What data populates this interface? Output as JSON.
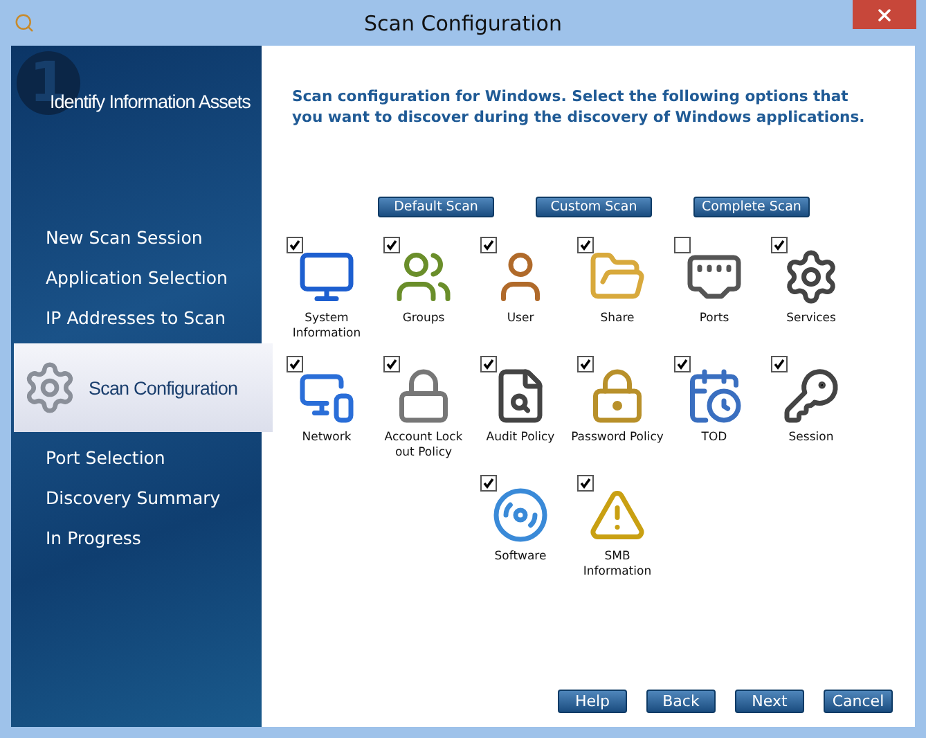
{
  "window": {
    "title": "Scan Configuration"
  },
  "sidebar": {
    "step_number": "1",
    "heading": "Identify Information Assets",
    "items": [
      {
        "label": "New Scan Session",
        "selected": false
      },
      {
        "label": "Application Selection",
        "selected": false
      },
      {
        "label": "IP Addresses to Scan",
        "selected": false
      },
      {
        "label": "Scan Configuration",
        "selected": true
      },
      {
        "label": "Port Selection",
        "selected": false
      },
      {
        "label": "Discovery Summary",
        "selected": false
      },
      {
        "label": "In Progress",
        "selected": false
      }
    ]
  },
  "intro": "Scan configuration for Windows. Select the following options that you want to discover during the discovery of Windows applications.",
  "scan_buttons": [
    "Default Scan",
    "Custom Scan",
    "Complete Scan"
  ],
  "option_rows": [
    [
      {
        "label": "System Information",
        "checked": true
      },
      {
        "label": "Groups",
        "checked": true
      },
      {
        "label": "User",
        "checked": true
      },
      {
        "label": "Share",
        "checked": true
      },
      {
        "label": "Ports",
        "checked": false
      },
      {
        "label": "Services",
        "checked": true
      }
    ],
    [
      {
        "label": "Network",
        "checked": true
      },
      {
        "label": "Account Lock out Policy",
        "checked": true
      },
      {
        "label": "Audit Policy",
        "checked": true
      },
      {
        "label": "Password Policy",
        "checked": true
      },
      {
        "label": "TOD",
        "checked": true
      },
      {
        "label": "Session",
        "checked": true
      }
    ],
    [
      {
        "label": "Software",
        "checked": true
      },
      {
        "label": "SMB Information",
        "checked": true
      }
    ]
  ],
  "footer_buttons": [
    "Help",
    "Back",
    "Next",
    "Cancel"
  ]
}
